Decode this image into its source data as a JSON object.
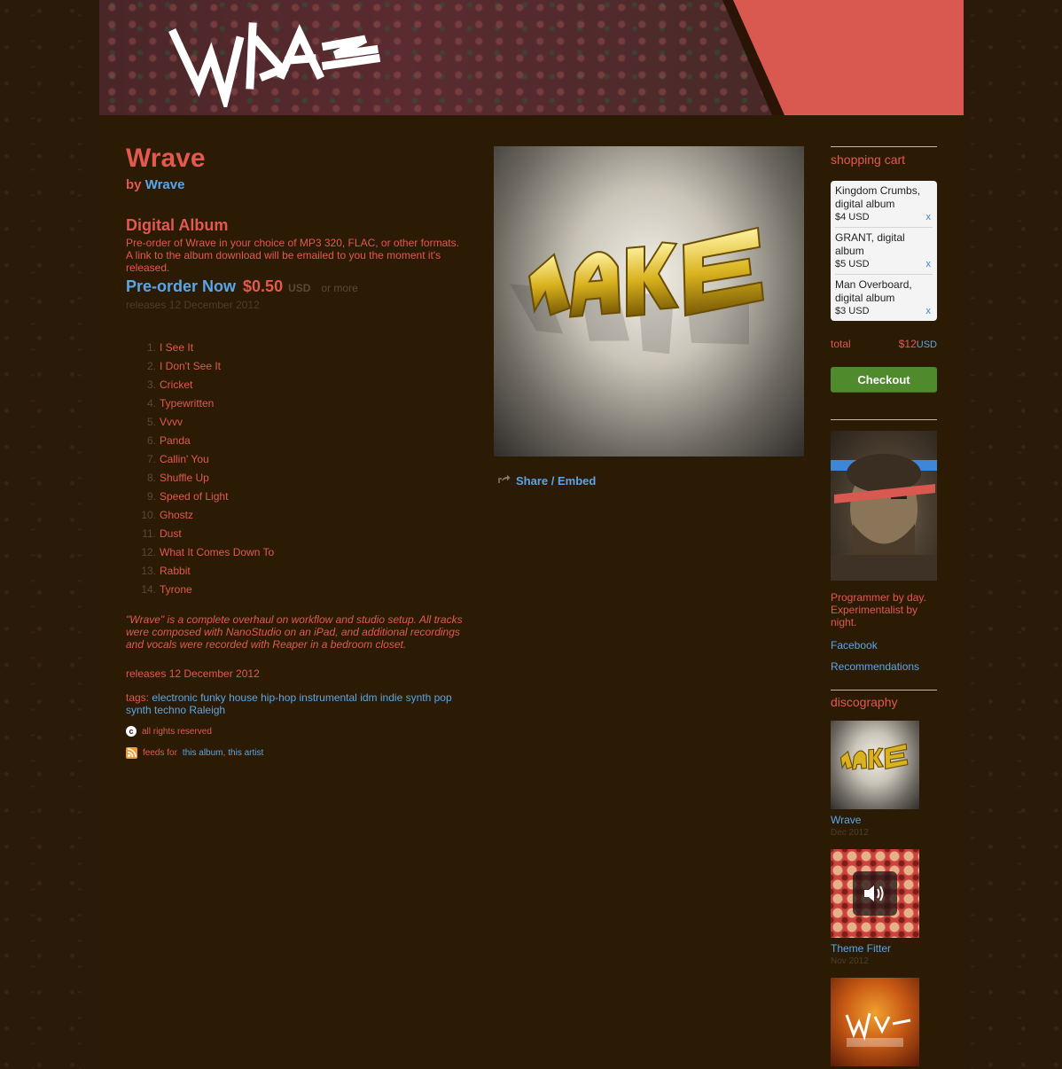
{
  "header": {
    "logo_text": "WRAVE"
  },
  "album": {
    "title": "Wrave",
    "by_prefix": "by",
    "artist": "Wrave",
    "format_title": "Digital Album",
    "format_desc": "Pre-order of Wrave in your choice of MP3 320, FLAC, or other formats. A link to the album download will be emailed to you the moment it's released.",
    "preorder_label": "Pre-order Now",
    "price": "$0.50",
    "currency": "USD",
    "or_more": "or more",
    "release_short": "releases 12 December 2012"
  },
  "tracks": [
    {
      "num": "1.",
      "title": "I See It"
    },
    {
      "num": "2.",
      "title": "I Don't See It"
    },
    {
      "num": "3.",
      "title": "Cricket"
    },
    {
      "num": "4.",
      "title": "Typewritten"
    },
    {
      "num": "5.",
      "title": "Vvvv"
    },
    {
      "num": "6.",
      "title": "Panda"
    },
    {
      "num": "7.",
      "title": "Callin' You"
    },
    {
      "num": "8.",
      "title": "Shuffle Up"
    },
    {
      "num": "9.",
      "title": "Speed of Light"
    },
    {
      "num": "10.",
      "title": "Ghostz"
    },
    {
      "num": "11.",
      "title": "Dust"
    },
    {
      "num": "12.",
      "title": "What It Comes Down To"
    },
    {
      "num": "13.",
      "title": "Rabbit"
    },
    {
      "num": "14.",
      "title": "Tyrone"
    }
  ],
  "about": "\"Wrave\" is a complete overhaul on workflow and studio setup. All tracks were composed with NanoStudio on an iPad, and additional recordings and vocals were recorded with Reaper in a bedroom closet.",
  "release_credit": "releases 12 December 2012",
  "tags": {
    "label": "tags:",
    "items": [
      "electronic",
      "funky house",
      "hip-hop instrumental",
      "idm",
      "indie synth pop",
      "synth",
      "techno",
      "Raleigh"
    ]
  },
  "license": "all rights reserved",
  "feeds": {
    "prefix": "feeds for",
    "album": "this album",
    "sep": ",",
    "artist": "this artist"
  },
  "share": {
    "label": "Share / Embed"
  },
  "cart": {
    "title": "shopping cart",
    "items": [
      {
        "name": "Kingdom Crumbs, digital album",
        "price": "$4 USD",
        "remove": "x"
      },
      {
        "name": "GRANT, digital album",
        "price": "$5 USD",
        "remove": "x"
      },
      {
        "name": "Man Overboard, digital album",
        "price": "$3 USD",
        "remove": "x"
      }
    ],
    "total_label": "total",
    "total_amount": "$12",
    "total_currency": "USD",
    "checkout_label": "Checkout"
  },
  "artist_panel": {
    "bio": "Programmer by day. Experimentalist by night.",
    "links": [
      "Facebook",
      "Recommendations"
    ]
  },
  "discography": {
    "title": "discography",
    "items": [
      {
        "name": "Wrave",
        "date": "Dec 2012"
      },
      {
        "name": "Theme Fitter",
        "date": "Nov 2012"
      }
    ]
  },
  "colors": {
    "accent_red": "#e2594f",
    "link_blue": "#5aa6e8",
    "page_bg": "#2b1b05",
    "checkout_green": "#4f8a2c"
  }
}
